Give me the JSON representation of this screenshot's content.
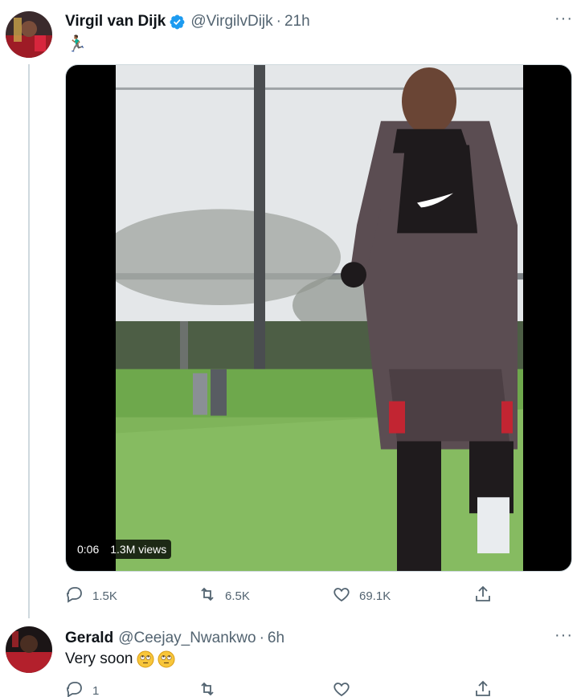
{
  "tweet": {
    "author_name": "Virgil van Dijk",
    "handle": "@VirgilvDijk",
    "separator": "·",
    "time": "21h",
    "text_emoji": "🏃🏾‍♂️",
    "video": {
      "elapsed": "0:06",
      "views": "1.3M views"
    },
    "actions": {
      "reply_count": "1.5K",
      "retweet_count": "6.5K",
      "like_count": "69.1K"
    }
  },
  "reply": {
    "author_name": "Gerald",
    "handle": "@Ceejay_Nwankwo",
    "separator": "·",
    "time": "6h",
    "text": "Very soon",
    "actions": {
      "reply_count": "1"
    }
  },
  "colors": {
    "verified": "#1d9bf0",
    "muted": "#536471",
    "thread_line": "#cfd9de"
  },
  "icons": [
    "verified-badge-icon",
    "more-options-icon",
    "reply-icon",
    "retweet-icon",
    "like-icon",
    "share-icon",
    "eye-roll-emoji"
  ]
}
